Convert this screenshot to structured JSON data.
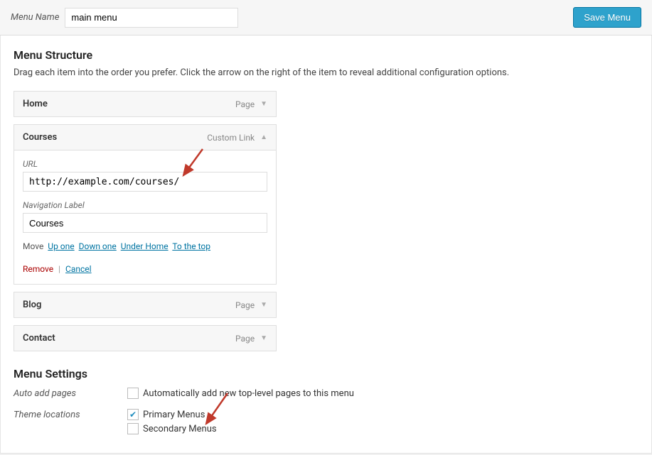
{
  "topbar": {
    "menu_name_label": "Menu Name",
    "menu_name_value": "main menu",
    "save_button": "Save Menu"
  },
  "structure": {
    "title": "Menu Structure",
    "desc": "Drag each item into the order you prefer. Click the arrow on the right of the item to reveal additional configuration options."
  },
  "items": {
    "home": {
      "title": "Home",
      "type": "Page"
    },
    "courses": {
      "title": "Courses",
      "type": "Custom Link",
      "url_label": "URL",
      "url_value": "http://example.com/courses/",
      "nav_label_label": "Navigation Label",
      "nav_label_value": "Courses",
      "move_label": "Move",
      "move_up": "Up one",
      "move_down": "Down one",
      "move_under": "Under Home",
      "move_top": "To the top",
      "remove": "Remove",
      "cancel": "Cancel"
    },
    "blog": {
      "title": "Blog",
      "type": "Page"
    },
    "contact": {
      "title": "Contact",
      "type": "Page"
    }
  },
  "settings": {
    "title": "Menu Settings",
    "auto_add_label": "Auto add pages",
    "auto_add_option": "Automatically add new top-level pages to this menu",
    "auto_add_checked": false,
    "locations_label": "Theme locations",
    "primary_label": "Primary Menus",
    "primary_checked": true,
    "secondary_label": "Secondary Menus",
    "secondary_checked": false
  }
}
